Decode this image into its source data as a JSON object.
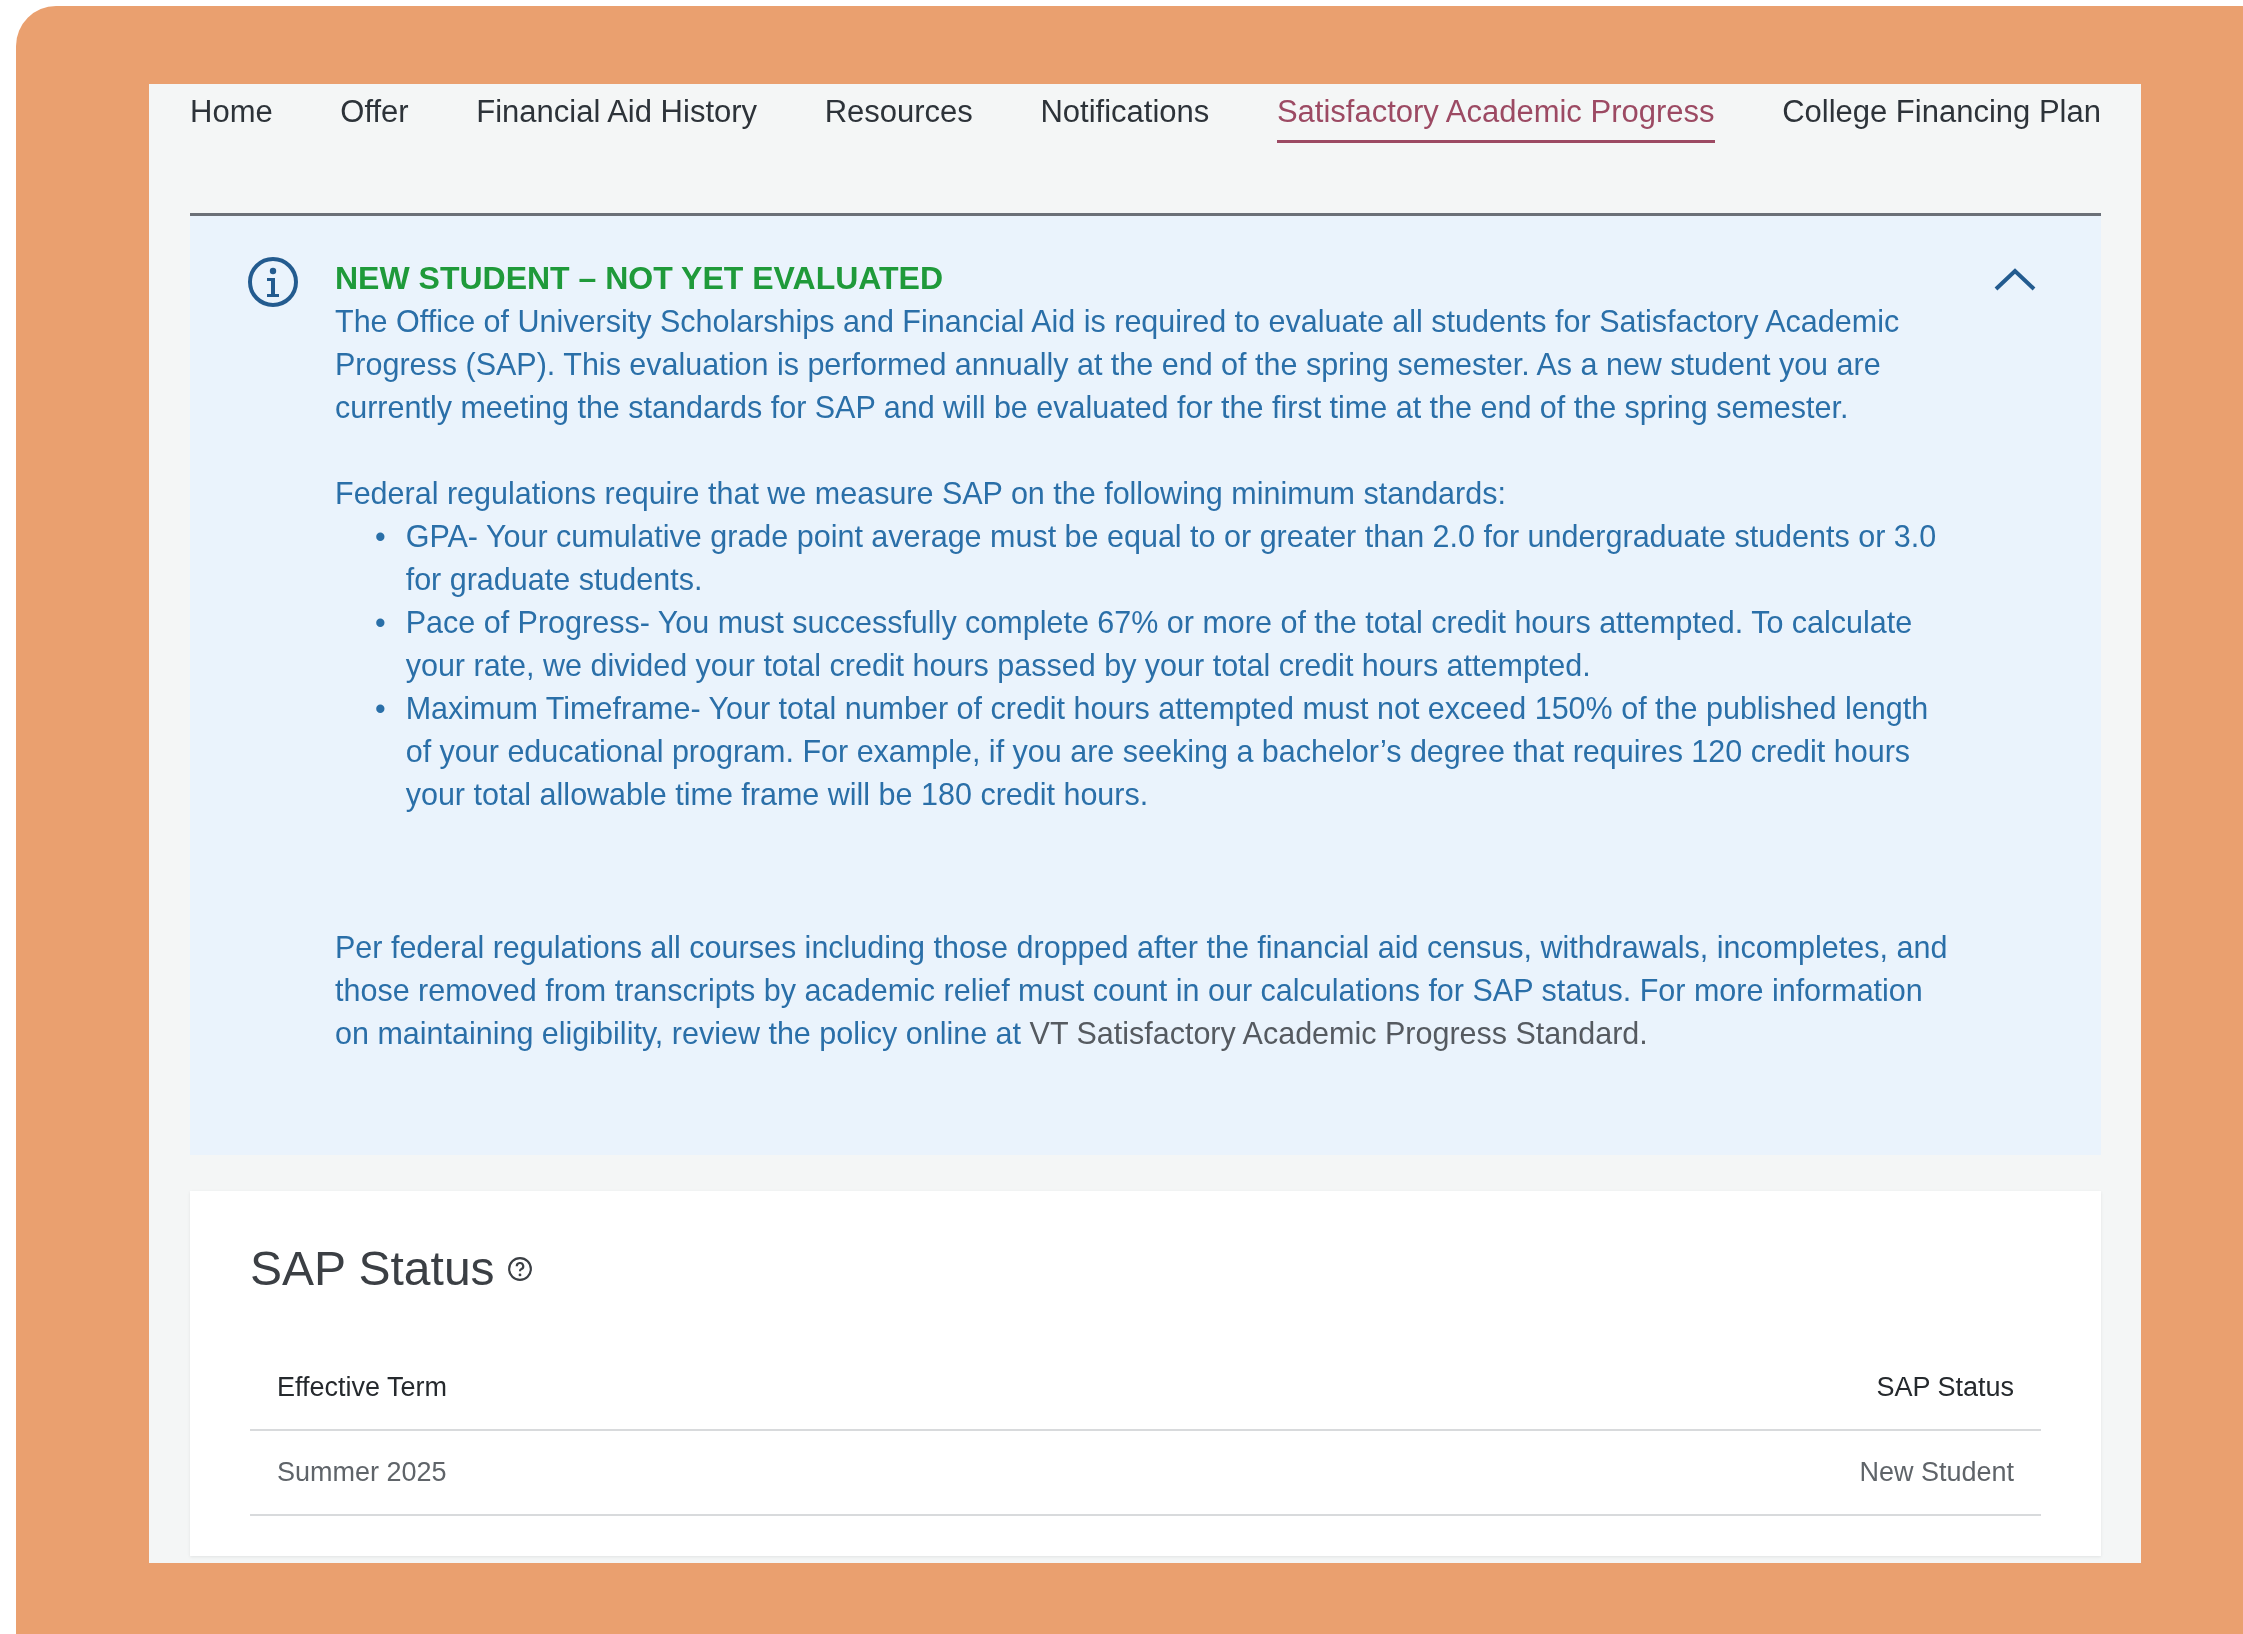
{
  "tabs": [
    {
      "label": "Home",
      "selected": false
    },
    {
      "label": "Offer",
      "selected": false
    },
    {
      "label": "Financial Aid History",
      "selected": false
    },
    {
      "label": "Resources",
      "selected": false
    },
    {
      "label": "Notifications",
      "selected": false
    },
    {
      "label": "Satisfactory Academic Progress",
      "selected": true
    },
    {
      "label": "College Financing Plan",
      "selected": false
    }
  ],
  "notice": {
    "title": "NEW STUDENT – NOT YET EVALUATED",
    "expanded": true,
    "intro": "The Office of University Scholarships and Financial Aid is required to evaluate all students for Satisfactory Academic Progress (SAP). This evaluation is performed annually at the end of the spring semester. As a new student you are currently meeting the standards for SAP and will be evaluated for the first time at the end of the spring semester.",
    "standards_lead": "Federal regulations require that we measure SAP on the following minimum standards:",
    "standards": [
      {
        "marker": "•",
        "text": "GPA- Your cumulative grade point average must be equal to or greater than 2.0 for undergraduate students or 3.0 for graduate students."
      },
      {
        "marker": "•",
        "text": "Pace of Progress- You must successfully complete 67% or more of the total credit hours attempted. To calculate your rate, we divided your total credit hours passed by your total credit hours attempted."
      },
      {
        "marker": "•",
        "text": "Maximum Timeframe- Your total number of credit hours attempted must not exceed 150% of the published length of your educational program. For example, if you are seeking a bachelor’s degree that requires 120 credit hours your total allowable time frame will be 180 credit hours."
      }
    ],
    "closing": "Per federal regulations all courses including those dropped after the financial aid census, withdrawals, incompletes, and those removed from transcripts by academic relief must count in our calculations for SAP status. For more information on maintaining eligibility, review the policy online at",
    "closing_link": "VT Satisfactory Academic Progress Standard."
  },
  "sap_status": {
    "title": "SAP Status",
    "columns": [
      "Effective Term",
      "SAP Status"
    ],
    "rows": [
      [
        "Summer 2025",
        "New Student"
      ]
    ]
  }
}
